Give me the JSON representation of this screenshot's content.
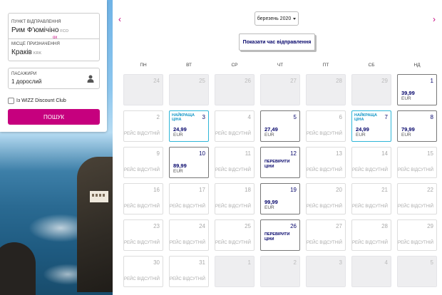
{
  "search": {
    "origin_label": "Пункт відправлення",
    "origin_value": "Рим Ф'юмічіно",
    "origin_code": "FCO",
    "swap_label": "ох",
    "dest_label": "Місце призначення",
    "dest_value": "Краків",
    "dest_code": "KRK",
    "pax_label": "Пасажири",
    "pax_value": "1 дорослий",
    "discount_label": "Із WIZZ Discount Club",
    "search_button": "Пошук"
  },
  "calendar": {
    "month": "березень 2020",
    "show_times": "Показати час відправлення",
    "prev_icon": "‹",
    "next_icon": "›",
    "weekdays": [
      "ПН",
      "ВТ",
      "СР",
      "ЧТ",
      "ПТ",
      "СБ",
      "НД"
    ],
    "na_text": "Рейс відсутній",
    "check_text": "Перевірити ціни",
    "best_text": "Найкраща ціна",
    "days": [
      {
        "num": "24",
        "type": "out"
      },
      {
        "num": "25",
        "type": "out"
      },
      {
        "num": "26",
        "type": "out"
      },
      {
        "num": "27",
        "type": "out"
      },
      {
        "num": "28",
        "type": "out"
      },
      {
        "num": "29",
        "type": "out"
      },
      {
        "num": "1",
        "type": "price",
        "amount": "39,99",
        "currency": "EUR"
      },
      {
        "num": "2",
        "type": "na"
      },
      {
        "num": "3",
        "type": "best",
        "amount": "24,99",
        "currency": "EUR"
      },
      {
        "num": "4",
        "type": "na"
      },
      {
        "num": "5",
        "type": "price",
        "amount": "27,49",
        "currency": "EUR"
      },
      {
        "num": "6",
        "type": "na"
      },
      {
        "num": "7",
        "type": "best",
        "amount": "24,99",
        "currency": "EUR"
      },
      {
        "num": "8",
        "type": "price",
        "amount": "79,99",
        "currency": "EUR"
      },
      {
        "num": "9",
        "type": "na"
      },
      {
        "num": "10",
        "type": "price",
        "amount": "89,99",
        "currency": "EUR"
      },
      {
        "num": "11",
        "type": "na"
      },
      {
        "num": "12",
        "type": "check"
      },
      {
        "num": "13",
        "type": "na"
      },
      {
        "num": "14",
        "type": "na"
      },
      {
        "num": "15",
        "type": "na"
      },
      {
        "num": "16",
        "type": "na"
      },
      {
        "num": "17",
        "type": "na"
      },
      {
        "num": "18",
        "type": "na"
      },
      {
        "num": "19",
        "type": "price",
        "amount": "99,99",
        "currency": "EUR"
      },
      {
        "num": "20",
        "type": "na"
      },
      {
        "num": "21",
        "type": "na"
      },
      {
        "num": "22",
        "type": "na"
      },
      {
        "num": "23",
        "type": "na"
      },
      {
        "num": "24",
        "type": "na"
      },
      {
        "num": "25",
        "type": "na"
      },
      {
        "num": "26",
        "type": "check"
      },
      {
        "num": "27",
        "type": "na"
      },
      {
        "num": "28",
        "type": "na"
      },
      {
        "num": "29",
        "type": "na"
      },
      {
        "num": "30",
        "type": "na"
      },
      {
        "num": "31",
        "type": "na"
      },
      {
        "num": "1",
        "type": "out"
      },
      {
        "num": "2",
        "type": "out"
      },
      {
        "num": "3",
        "type": "out"
      },
      {
        "num": "4",
        "type": "out"
      },
      {
        "num": "5",
        "type": "out"
      }
    ]
  },
  "colors": {
    "accent": "#c6007e",
    "navy": "#06066b",
    "best_border": "#2fb6d8"
  }
}
